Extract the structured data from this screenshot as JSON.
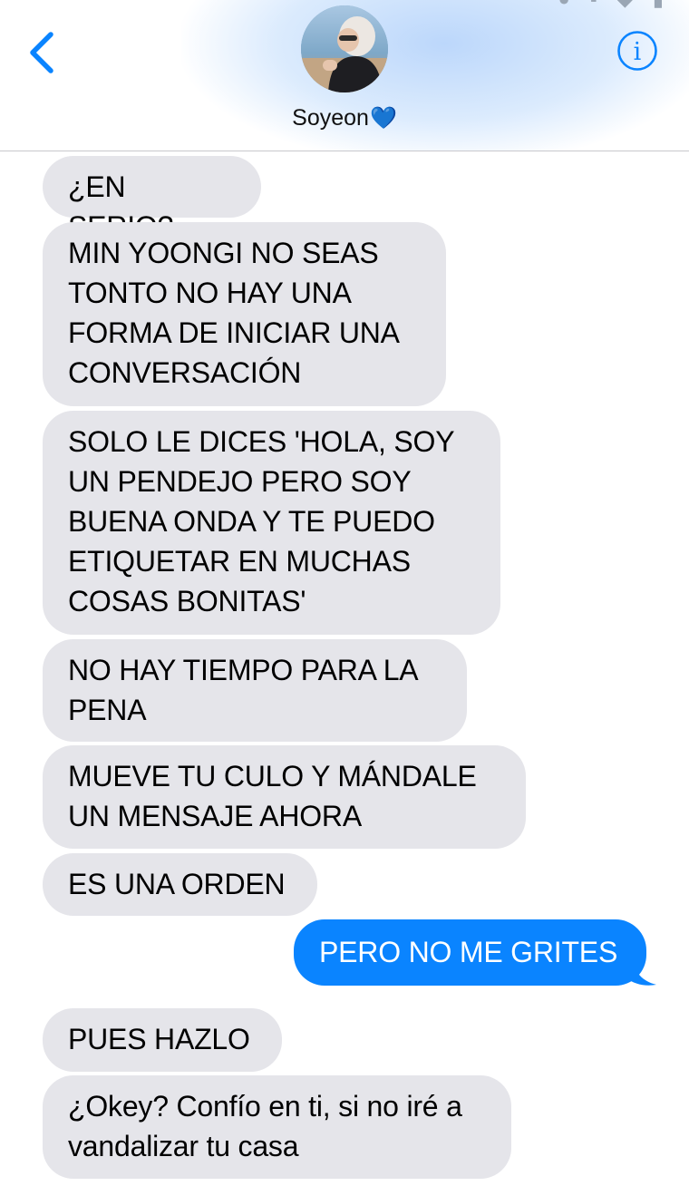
{
  "colors": {
    "incoming_bubble": "#e5e5ea",
    "outgoing_bubble": "#0a84ff",
    "accent": "#0a84ff"
  },
  "header": {
    "contact_name": "Soyeon",
    "contact_emoji": "💙",
    "back_icon": "chevron-left-icon",
    "info_icon": "info-icon"
  },
  "messages": [
    {
      "sender": "contact",
      "text": "¿EN SERIO?"
    },
    {
      "sender": "contact",
      "text": "MIN YOONGI NO SEAS\nTONTO NO HAY UNA\nFORMA DE INICIAR UNA\nCONVERSACIÓN"
    },
    {
      "sender": "contact",
      "text": "SOLO LE DICES 'HOLA, SOY\nUN PENDEJO PERO SOY\nBUENA ONDA Y TE PUEDO\nETIQUETAR EN MUCHAS\nCOSAS BONITAS'"
    },
    {
      "sender": "contact",
      "text": "NO HAY TIEMPO PARA LA\nPENA"
    },
    {
      "sender": "contact",
      "text": "MUEVE TU CULO Y MÁNDALE\nUN MENSAJE AHORA"
    },
    {
      "sender": "contact",
      "text": "ES UNA ORDEN"
    },
    {
      "sender": "me",
      "text": "PERO NO ME GRITES"
    },
    {
      "sender": "contact",
      "text": "PUES HAZLO"
    },
    {
      "sender": "contact",
      "text": "¿Okey? Confío en ti, si no iré a\nvandalizar tu casa"
    }
  ]
}
